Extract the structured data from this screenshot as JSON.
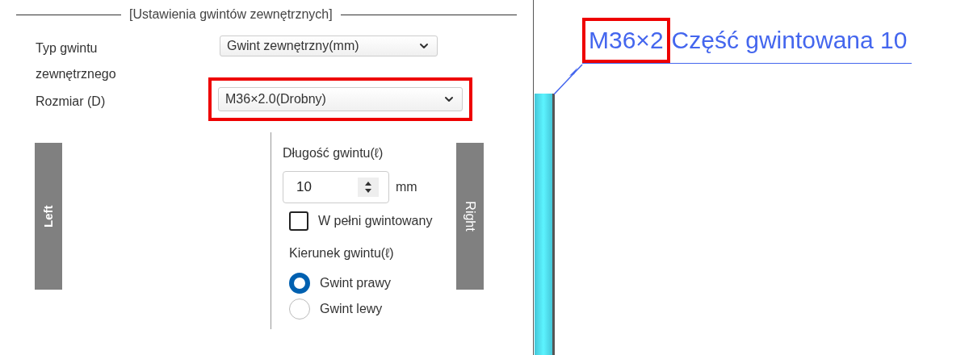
{
  "settings": {
    "title": "[Ustawienia gwintów zewnętrznych]",
    "fields": [
      {
        "label": "Typ gwintu zewnętrznego",
        "value": "Gwint zewnętrzny(mm)",
        "highlighted": false
      },
      {
        "label": "Rozmiar (D)",
        "value": "M36×2.0(Drobny)",
        "highlighted": true
      }
    ],
    "left_button": "Left",
    "right_button": "Right",
    "length": {
      "label": "Długość gwintu(ℓ)",
      "value": "10",
      "unit": "mm"
    },
    "fully_threaded": {
      "label": "W pełni gwintowany",
      "checked": false
    },
    "direction": {
      "label": "Kierunek gwintu(ℓ)",
      "options": [
        {
          "label": "Gwint prawy",
          "selected": true
        },
        {
          "label": "Gwint lewy",
          "selected": false
        }
      ]
    }
  },
  "callout": {
    "size": "M36×2",
    "size_highlighted": true,
    "text": "Część gwintowana 10"
  }
}
